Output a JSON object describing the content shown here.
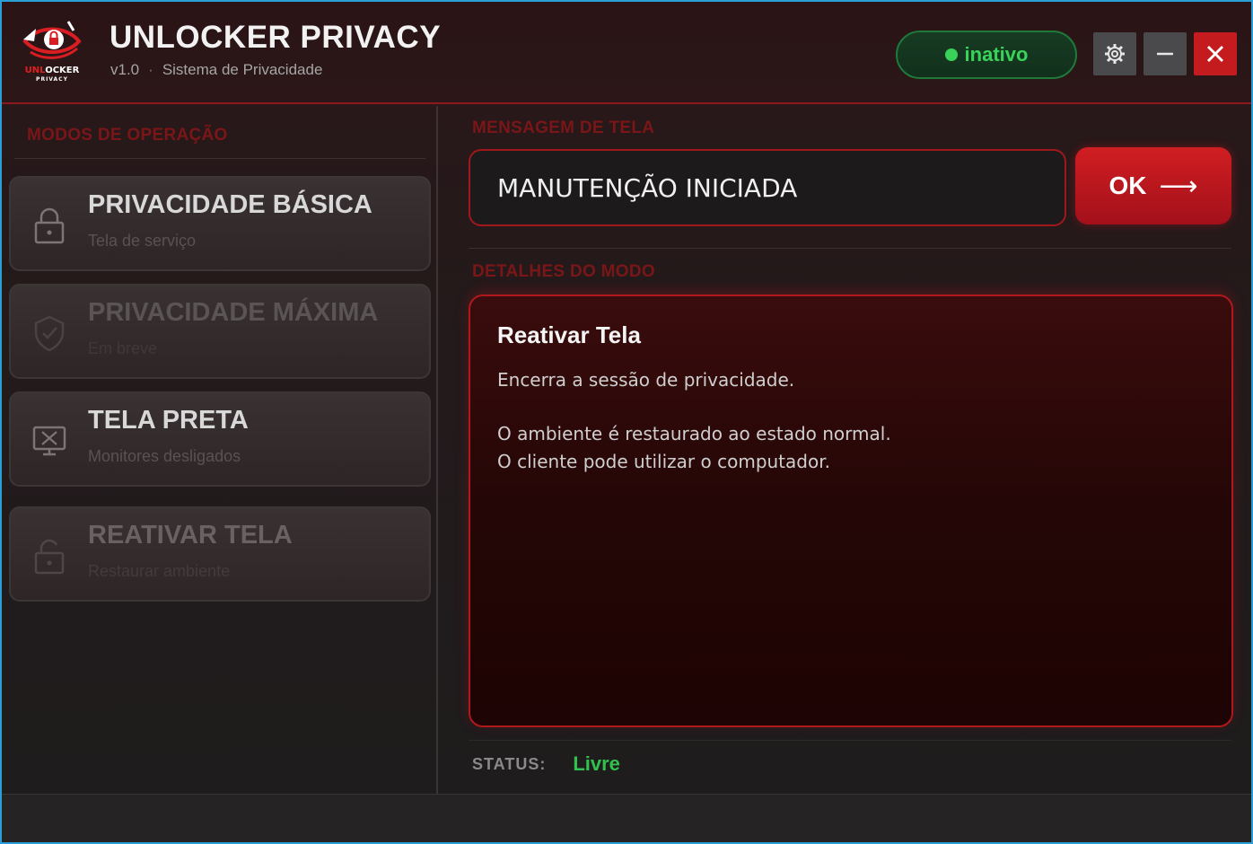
{
  "app": {
    "logo_word_red": "UNL",
    "logo_word_white": "OCKER",
    "logo_sub": "PRIVACY",
    "title": "UNLOCKER PRIVACY",
    "version": "v1.0",
    "subtitle": "Sistema de Privacidade"
  },
  "header": {
    "status_text": "inativo",
    "status_color": "#3ad35a",
    "settings_icon": "gear-icon",
    "minimize_icon": "minimize-icon",
    "close_icon": "close-icon"
  },
  "sidebar": {
    "section_label": "MODOS DE OPERAÇÃO",
    "modes": [
      {
        "title": "PRIVACIDADE BÁSICA",
        "desc": "Tela de serviço",
        "icon": "lock-icon",
        "state": "enabled"
      },
      {
        "title": "PRIVACIDADE MÁXIMA",
        "desc": "Em breve",
        "icon": "shield-check-icon",
        "state": "disabled"
      },
      {
        "title": "TELA PRETA",
        "desc": "Monitores desligados",
        "icon": "monitor-off-icon",
        "state": "enabled"
      },
      {
        "title": "REATIVAR TELA",
        "desc": "Restaurar ambiente",
        "icon": "unlock-icon",
        "state": "dim"
      }
    ]
  },
  "main": {
    "message_label": "MENSAGEM DE TELA",
    "message_value": "MANUTENÇÃO INICIADA",
    "ok_label": "OK",
    "ok_arrow": "⟶",
    "details_label": "DETALHES DO MODO",
    "details": {
      "title": "Reativar Tela",
      "line1": "Encerra a sessão de privacidade.",
      "line2": "O ambiente é restaurado ao estado normal.",
      "line3": "O cliente pode utilizar o computador."
    },
    "status_key": "STATUS:",
    "status_value": "Livre"
  },
  "colors": {
    "accent_red": "#c41b1e",
    "status_green": "#31c24e",
    "window_border": "#2a9fd6"
  }
}
